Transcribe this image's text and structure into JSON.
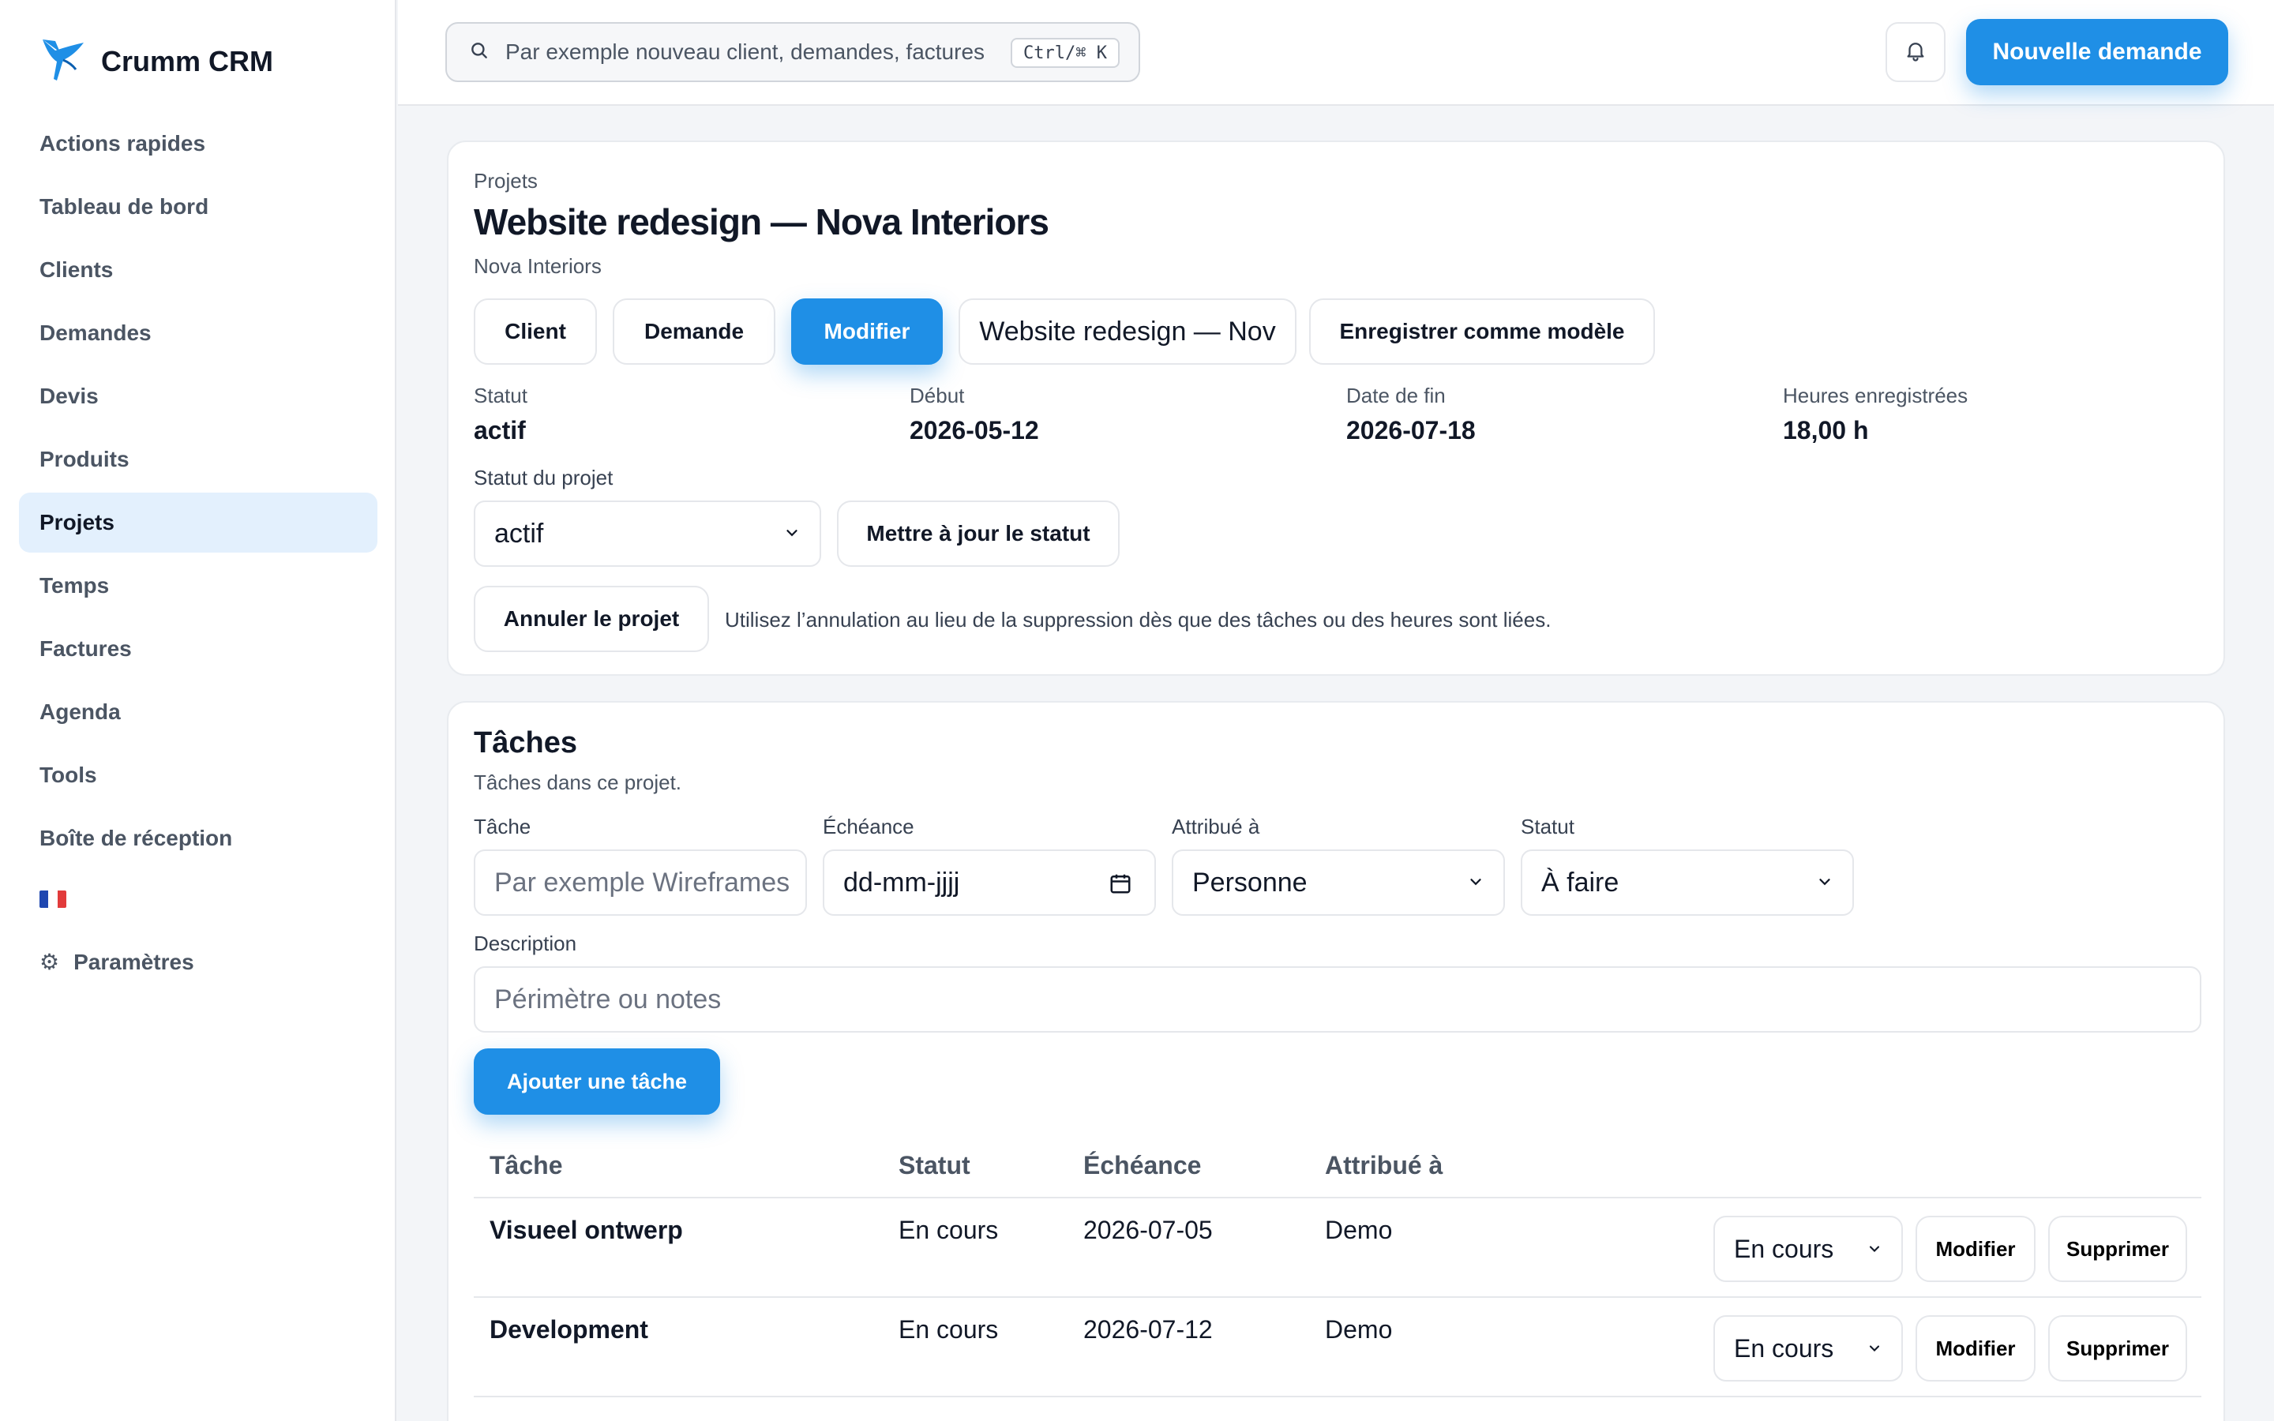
{
  "app": {
    "name": "Crumm CRM"
  },
  "sidebar": {
    "items": [
      {
        "label": "Actions rapides"
      },
      {
        "label": "Tableau de bord"
      },
      {
        "label": "Clients"
      },
      {
        "label": "Demandes"
      },
      {
        "label": "Devis"
      },
      {
        "label": "Produits"
      },
      {
        "label": "Projets",
        "active": true
      },
      {
        "label": "Temps"
      },
      {
        "label": "Factures"
      },
      {
        "label": "Agenda"
      },
      {
        "label": "Tools"
      },
      {
        "label": "Boîte de réception"
      }
    ],
    "settings_label": "Paramètres",
    "flag_colors": [
      "#1f47b0",
      "#ffffff",
      "#e23b3b"
    ]
  },
  "header": {
    "search_placeholder": "Par exemple nouveau client, demandes, factures",
    "shortcut": "Ctrl/⌘ K",
    "new_request_label": "Nouvelle demande"
  },
  "project": {
    "breadcrumb": "Projets",
    "title": "Website redesign — Nova Interiors",
    "client_name": "Nova Interiors",
    "actions": {
      "client": "Client",
      "request": "Demande",
      "edit": "Modifier",
      "name_field": "Website redesign — Nov",
      "save_template": "Enregistrer comme modèle"
    },
    "stats": [
      {
        "label": "Statut",
        "value": "actif"
      },
      {
        "label": "Début",
        "value": "2026-05-12"
      },
      {
        "label": "Date de fin",
        "value": "2026-07-18"
      },
      {
        "label": "Heures enregistrées",
        "value": "18,00 h"
      }
    ],
    "status_label": "Statut du projet",
    "status_value": "actif",
    "update_status": "Mettre à jour le statut",
    "cancel_project": "Annuler le projet",
    "cancel_hint": "Utilisez l’annulation au lieu de la suppression dès que des tâches ou des heures sont liées."
  },
  "tasks": {
    "title": "Tâches",
    "subtitle": "Tâches dans ce projet.",
    "form": {
      "task_label": "Tâche",
      "task_placeholder": "Par exemple Wireframes",
      "due_label": "Échéance",
      "due_placeholder": "dd-mm-jjjj",
      "assignee_label": "Attribué à",
      "assignee_value": "Personne",
      "status_label": "Statut",
      "status_value": "À faire",
      "description_label": "Description",
      "description_placeholder": "Périmètre ou notes",
      "add_label": "Ajouter une tâche"
    },
    "columns": [
      "Tâche",
      "Statut",
      "Échéance",
      "Attribué à"
    ],
    "rows": [
      {
        "name": "Visueel ontwerp",
        "status": "En cours",
        "due": "2026-07-05",
        "assignee": "Demo",
        "status_select": "En cours",
        "edit": "Modifier",
        "delete": "Supprimer"
      },
      {
        "name": "Development",
        "status": "En cours",
        "due": "2026-07-12",
        "assignee": "Demo",
        "status_select": "En cours",
        "edit": "Modifier",
        "delete": "Supprimer"
      }
    ]
  }
}
